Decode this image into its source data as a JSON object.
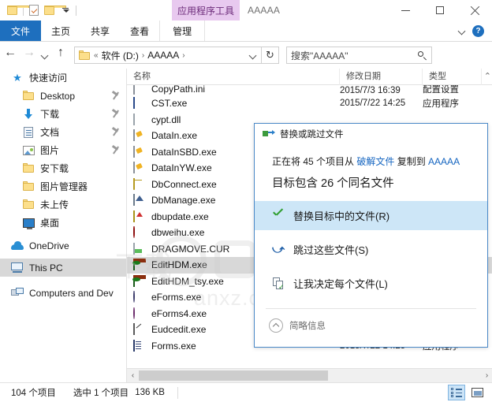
{
  "titlebar": {
    "quick_access": [
      {
        "icon": "folder-icon",
        "name": "qat-folder"
      },
      {
        "icon": "document-check-icon",
        "name": "qat-properties"
      },
      {
        "icon": "folder-icon",
        "name": "qat-new-folder"
      },
      {
        "icon": "chevron-down-icon",
        "name": "qat-customize"
      }
    ],
    "contextual_tab": "应用程序工具",
    "window_title": "AAAAA",
    "minimize": "—",
    "maximize": "▢",
    "close": "✕",
    "contextual_tab_color": "#e8c9ef"
  },
  "ribbon": {
    "tabs": [
      {
        "label": "文件",
        "active_file": true
      },
      {
        "label": "主页",
        "active_file": false
      },
      {
        "label": "共享",
        "active_file": false
      },
      {
        "label": "查看",
        "active_file": false
      },
      {
        "label": "管理",
        "active_file": false
      }
    ],
    "collapse_icon": "chevron-down-icon",
    "help_label": "?",
    "file_tab_color": "#1e6fbe"
  },
  "addressbar": {
    "back": "←",
    "forward": "→",
    "recent": "chevron-down-icon",
    "up": "↑",
    "breadcrumb": {
      "overflow": "«",
      "items": [
        "软件 (D:)",
        "AAAAA"
      ],
      "separator": "›",
      "dropdown": "chevron-down-icon"
    },
    "refresh": "↻",
    "search": {
      "value": "搜索\"AAAAA\"",
      "icon": "search-icon"
    }
  },
  "navpane": {
    "items": [
      {
        "label": "快速访问",
        "icon": "star-icon",
        "level": "root",
        "pinned": false,
        "selected": false
      },
      {
        "label": "Desktop",
        "icon": "folder-icon",
        "level": "child",
        "pinned": true,
        "selected": false
      },
      {
        "label": "下载",
        "icon": "download-icon",
        "level": "child",
        "pinned": true,
        "selected": false
      },
      {
        "label": "文档",
        "icon": "document-icon",
        "level": "child",
        "pinned": true,
        "selected": false
      },
      {
        "label": "图片",
        "icon": "picture-icon",
        "level": "child",
        "pinned": true,
        "selected": false
      },
      {
        "label": "安下载",
        "icon": "folder-icon",
        "level": "child",
        "pinned": false,
        "selected": false
      },
      {
        "label": "图片管理器",
        "icon": "folder-icon",
        "level": "child",
        "pinned": false,
        "selected": false
      },
      {
        "label": "未上传",
        "icon": "folder-icon",
        "level": "child",
        "pinned": false,
        "selected": false
      },
      {
        "label": "桌面",
        "icon": "monitor-icon",
        "level": "child",
        "pinned": false,
        "selected": false
      },
      {
        "label": "OneDrive",
        "icon": "cloud-icon",
        "level": "root",
        "pinned": false,
        "selected": false
      },
      {
        "label": "This PC",
        "icon": "this-pc-icon",
        "level": "root",
        "pinned": false,
        "selected": true
      },
      {
        "label": "Computers and Dev",
        "icon": "network-icon",
        "level": "root",
        "pinned": false,
        "selected": false
      }
    ]
  },
  "filelist": {
    "columns": [
      {
        "label": "名称",
        "key": "name"
      },
      {
        "label": "修改日期",
        "key": "date"
      },
      {
        "label": "类型",
        "key": "type"
      }
    ],
    "scroll_up_icon": "chevron-up-icon",
    "rows": [
      {
        "name": "CopyPath.ini",
        "icon": "ini-file-icon",
        "date": "2015/7/3 16:39",
        "type": "配置设置",
        "selected": false,
        "clipped": true
      },
      {
        "name": "CST.exe",
        "icon": "app-blue-icon",
        "date": "2015/7/22 14:25",
        "type": "应用程序",
        "selected": false
      },
      {
        "name": "cypt.dll",
        "icon": "dll-file-icon",
        "date": "",
        "type": "",
        "selected": false
      },
      {
        "name": "DataIn.exe",
        "icon": "app-diamond-icon",
        "date": "",
        "type": "",
        "selected": false
      },
      {
        "name": "DataInSBD.exe",
        "icon": "app-diamond-icon",
        "date": "",
        "type": "",
        "selected": false
      },
      {
        "name": "DataInYW.exe",
        "icon": "app-diamond-icon",
        "date": "",
        "type": "",
        "selected": false
      },
      {
        "name": "DbConnect.exe",
        "icon": "app-cylinder-icon",
        "date": "",
        "type": "",
        "selected": false
      },
      {
        "name": "DbManage.exe",
        "icon": "app-house-icon",
        "date": "",
        "type": "",
        "selected": false
      },
      {
        "name": "dbupdate.exe",
        "icon": "app-update-icon",
        "date": "",
        "type": "",
        "selected": false
      },
      {
        "name": "dbweihu.exe",
        "icon": "app-gear-red-icon",
        "date": "",
        "type": "",
        "selected": false
      },
      {
        "name": "DRAGMOVE.CUR",
        "icon": "cursor-file-icon",
        "date": "",
        "type": "",
        "selected": false
      },
      {
        "name": "EditHDM.exe",
        "icon": "app-landscape-icon",
        "date": "",
        "type": "",
        "selected": true
      },
      {
        "name": "EditHDM_tsy.exe",
        "icon": "app-landscape-icon",
        "date": "",
        "type": "",
        "selected": false
      },
      {
        "name": "eForms.exe",
        "icon": "app-globe-icon",
        "date": "",
        "type": "",
        "selected": false
      },
      {
        "name": "eForms4.exe",
        "icon": "app-globe-pink-icon",
        "date": "",
        "type": "",
        "selected": false
      },
      {
        "name": "Eudcedit.exe",
        "icon": "app-pencil-icon",
        "date": "",
        "type": "",
        "selected": false
      },
      {
        "name": "Forms.exe",
        "icon": "app-form-icon",
        "date": "2015/7/22 14:25",
        "type": "应用程序",
        "selected": false
      }
    ],
    "hscroll": {
      "left_arrow": "‹",
      "right_arrow": "›"
    },
    "watermark": {
      "text": "anxz.com",
      "text2": "下载"
    }
  },
  "dialog": {
    "header": {
      "title": "替换或跳过文件",
      "icon": "copy-move-icon"
    },
    "line1": {
      "prefix": "正在将 45 个项目从 ",
      "source": "破解文件",
      "middle": " 复制到 ",
      "dest": "AAAAA"
    },
    "line2": "目标包含 26 个同名文件",
    "options": [
      {
        "label": "替换目标中的文件(R)",
        "icon": "green-check-icon",
        "highlighted": true
      },
      {
        "label": "跳过这些文件(S)",
        "icon": "skip-arrow-icon",
        "highlighted": false
      },
      {
        "label": "让我决定每个文件(L)",
        "icon": "compare-files-icon",
        "highlighted": false
      }
    ],
    "footer": {
      "label": "简略信息",
      "icon": "chevron-up-circle-icon"
    },
    "accent_color": "#cde6f7",
    "border_color": "#4a88c7"
  },
  "statusbar": {
    "item_count": "104 个项目",
    "selection": "选中 1 个项目",
    "size": "136 KB",
    "views": [
      {
        "name": "details-view",
        "icon": "details-view-icon",
        "active": true
      },
      {
        "name": "large-icons-view",
        "icon": "tiles-view-icon",
        "active": false
      }
    ]
  }
}
